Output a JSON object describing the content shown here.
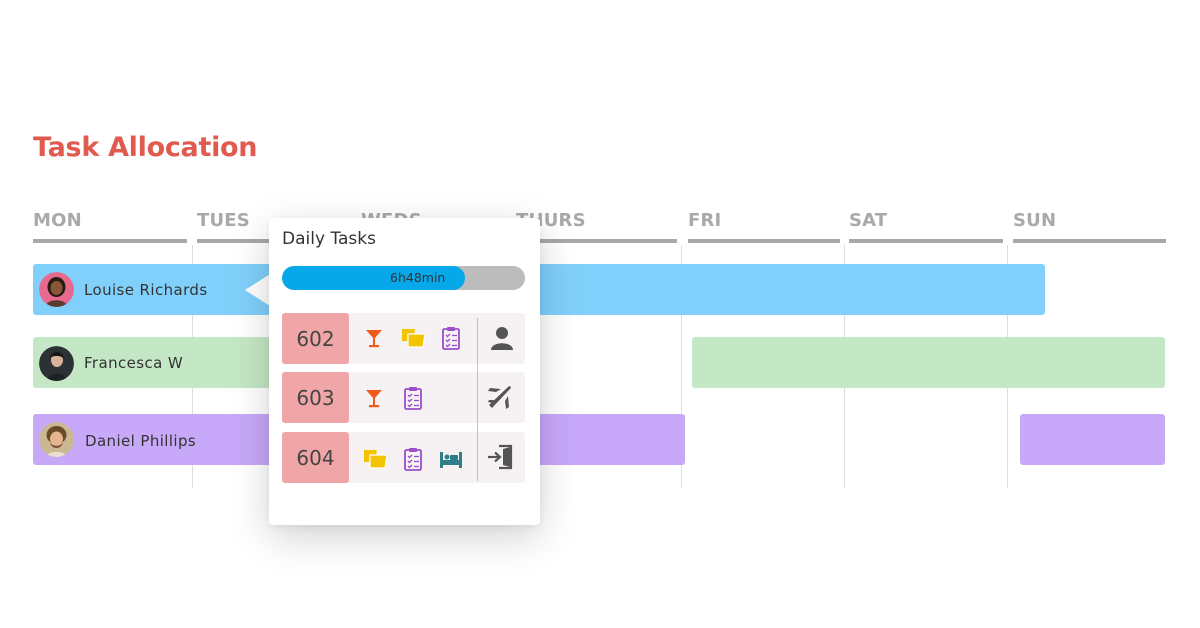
{
  "page": {
    "title": "Task Allocation"
  },
  "days": [
    "MON",
    "TUES",
    "WEDS",
    "THURS",
    "FRI",
    "SAT",
    "SUN"
  ],
  "staff": [
    {
      "name": "Louise Richards",
      "bar_color": "#80d0fb"
    },
    {
      "name": "Francesca W",
      "bar_color": "#c4e8c5"
    },
    {
      "name": "Daniel Phillips",
      "bar_color": "#c8a8f9"
    }
  ],
  "popup": {
    "title": "Daily Tasks",
    "progress_text": "6h48min",
    "progress_fraction": 0.755,
    "rooms": [
      {
        "number": "602",
        "tasks": [
          "cocktail-icon",
          "towels-icon",
          "checklist-icon"
        ],
        "status": "person-icon"
      },
      {
        "number": "603",
        "tasks": [
          "cocktail-icon",
          "checklist-icon"
        ],
        "status": "departure-plane-icon"
      },
      {
        "number": "604",
        "tasks": [
          "towels-icon",
          "checklist-icon",
          "bed-icon"
        ],
        "status": "checkin-door-icon"
      }
    ]
  },
  "colors": {
    "title": "#e05a50",
    "progress": "#07a8ea",
    "room_badge": "#f0a6a6",
    "cocktail": "#f05a1a",
    "towels": "#f5c400",
    "checklist": "#9b4dca",
    "bed": "#2f7f8a"
  }
}
